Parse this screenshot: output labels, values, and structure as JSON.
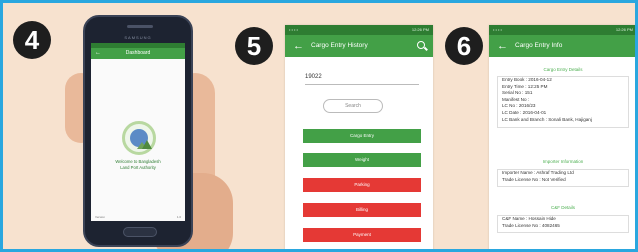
{
  "badges": {
    "step4": "4",
    "step5": "5",
    "step6": "6"
  },
  "phone": {
    "brand": "SAMSUNG",
    "screen_title": "Dashboard",
    "welcome_line1": "Welcome to Bangladesh",
    "welcome_line2": "Land Port Authority",
    "footer_left": "Version",
    "footer_right": "1.0"
  },
  "screen5": {
    "status_left": "• • • •",
    "status_right": "12:26 PM",
    "title": "Cargo Entry History",
    "input_value": "19022",
    "search_label": "Search",
    "buttons": [
      {
        "label": "Cargo Entry",
        "color": "green"
      },
      {
        "label": "Weight",
        "color": "green"
      },
      {
        "label": "Parking",
        "color": "red"
      },
      {
        "label": "Billing",
        "color": "red"
      },
      {
        "label": "Payment",
        "color": "red"
      }
    ]
  },
  "screen6": {
    "status_left": "• • • •",
    "status_right": "12:26 PM",
    "title": "Cargo Entry Info",
    "section1": "Cargo Entry Details",
    "rows1": [
      "Entry Book : 2016-04-12",
      "Entry Time : 12:25 PM",
      "Serial No : 151",
      "Manifest No :",
      "LC No : 2016/23",
      "LC Date : 2016-04-01",
      "LC Bank and Branch : Sonali Bank, Hajiganj"
    ],
    "section2": "Importer Information",
    "rows2": [
      "Importer Name : Ashraf Trading Ltd",
      "Trade License No : Not Verified"
    ],
    "section3": "C&F Details",
    "rows3": [
      "C&F Name : Hossain Hide",
      "Trade License No : 4082465"
    ]
  },
  "colors": {
    "frame": "#2aa7df",
    "background": "#f7e2cf",
    "appbar": "#43a047",
    "danger": "#e53935"
  }
}
